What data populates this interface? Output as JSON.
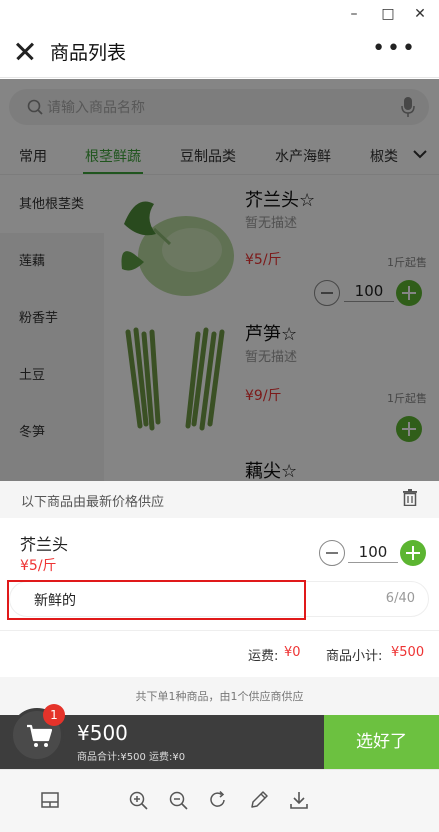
{
  "window": {
    "minimize": "–",
    "maximize": "□",
    "close": "✕"
  },
  "header": {
    "title": "商品列表",
    "more": "•••"
  },
  "search": {
    "placeholder": "请输入商品名称"
  },
  "categories": [
    "常用",
    "根茎鲜蔬",
    "豆制品类",
    "水产海鲜",
    "椒类"
  ],
  "active_category": "根茎鲜蔬",
  "subcategories": [
    "其他根茎类",
    "莲藕",
    "粉香芋",
    "土豆",
    "冬笋"
  ],
  "products": [
    {
      "name": "芥兰头☆",
      "desc": "暂无描述",
      "price": "¥5/斤",
      "moq": "1斤起售",
      "qty": "100"
    },
    {
      "name": "芦笋☆",
      "desc": "暂无描述",
      "price": "¥9/斤",
      "moq": "1斤起售"
    },
    {
      "name": "藕尖☆"
    }
  ],
  "popup": {
    "header": "以下商品由最新价格供应",
    "item": {
      "name": "芥兰头",
      "price": "¥5/斤",
      "qty": "100"
    },
    "note": {
      "value": "新鲜的",
      "count": "6/40"
    },
    "shipping_label": "运费:",
    "shipping_value": "¥0",
    "subtotal_label": "商品小计:",
    "subtotal_value": "¥500",
    "footer": "共下单1种商品，由1个供应商供应"
  },
  "cart": {
    "badge": "1",
    "total": "¥500",
    "detail": "商品合计:¥500   运费:¥0",
    "checkout": "选好了"
  },
  "colors": {
    "accent": "#6cc140",
    "price": "#e33333",
    "highlight": "#e0191a"
  }
}
